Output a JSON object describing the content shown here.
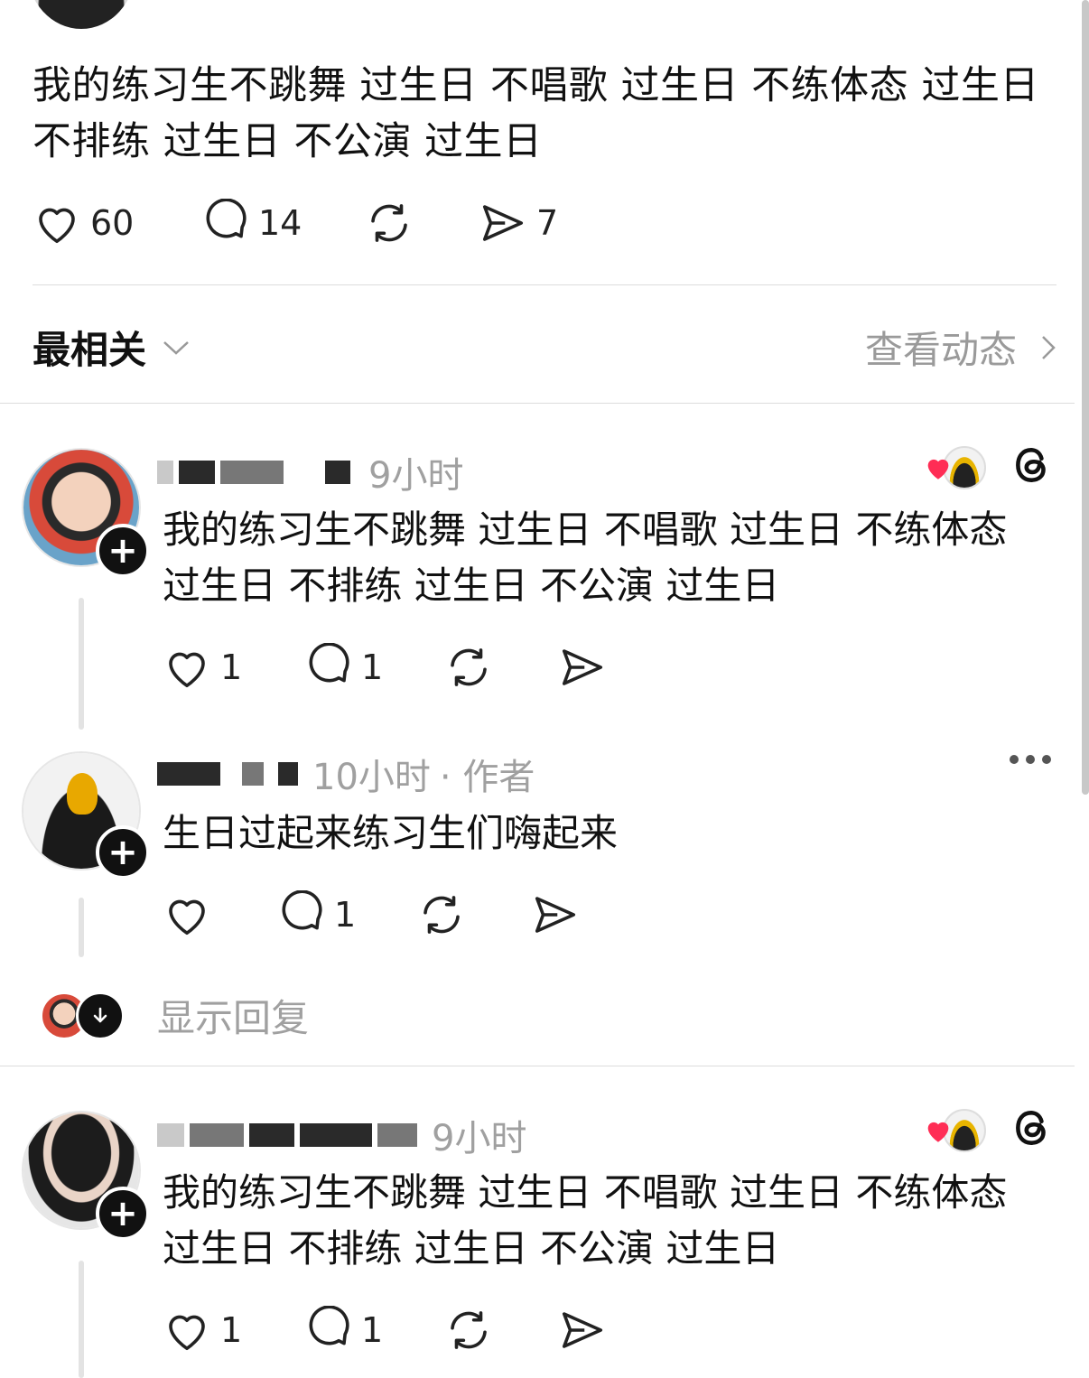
{
  "post": {
    "text_line1": "我的练习生不跳舞 过生日 不唱歌 过生日 不练体态 过生日",
    "text_line2": "不排练 过生日 不公演 过生日",
    "likes": "60",
    "comments": "14",
    "shares": "7"
  },
  "sort": {
    "label": "最相关"
  },
  "activity": {
    "label": "查看动态"
  },
  "comments": [
    {
      "time": "9小时",
      "text_line1": "我的练习生不跳舞 过生日 不唱歌 过生日 不练体态",
      "text_line2": "过生日 不排练 过生日 不公演 过生日",
      "likes": "1",
      "replies": "1"
    },
    {
      "time": "10小时",
      "author_badge": "· 作者",
      "text": "生日过起来练习生们嗨起来",
      "likes": "",
      "replies": "1"
    },
    {
      "time": "9小时",
      "text_line1": "我的练习生不跳舞 过生日 不唱歌 过生日 不练体态",
      "text_line2": "过生日 不排练 过生日 不公演 过生日",
      "likes": "1",
      "replies": "1"
    }
  ],
  "show_replies": {
    "label": "显示回复"
  },
  "colors": {
    "accent_heart": "#ff2d55",
    "muted": "#9a9a9a",
    "text": "#111111"
  },
  "icons": [
    "heart-icon",
    "comment-icon",
    "repost-icon",
    "send-icon",
    "chevron-down-icon",
    "chevron-right-icon",
    "plus-icon",
    "threads-icon",
    "more-icon",
    "arrow-down-icon"
  ]
}
